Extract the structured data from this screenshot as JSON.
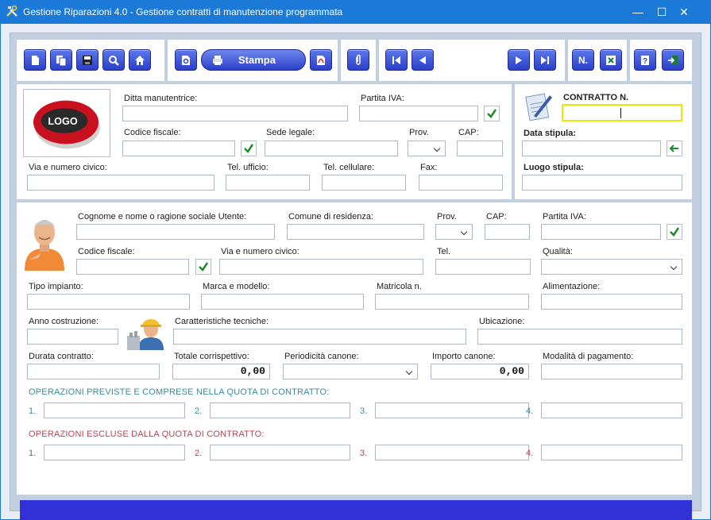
{
  "window": {
    "title": "Gestione Riparazioni 4.0 - Gestione contratti di manutenzione programmata",
    "minimize": "—",
    "maximize": "☐",
    "close": "✕"
  },
  "toolbar": {
    "stampa_label": "Stampa",
    "numero_label": "N.",
    "help_label": "?"
  },
  "maintainer": {
    "logo_text": "LOGO",
    "ditta_label": "Ditta manutentrice:",
    "piva_label": "Partita IVA:",
    "cf_label": "Codice fiscale:",
    "sede_label": "Sede legale:",
    "prov_label": "Prov.",
    "cap_label": "CAP:",
    "via_label": "Via e numero civico:",
    "tel_ufficio_label": "Tel. ufficio:",
    "tel_cell_label": "Tel. cellulare:",
    "fax_label": "Fax:"
  },
  "contract": {
    "numero_label": "CONTRATTO N.",
    "data_label": "Data stipula:",
    "luogo_label": "Luogo stipula:"
  },
  "user": {
    "nome_label": "Cognome e nome o ragione sociale Utente:",
    "comune_label": "Comune di residenza:",
    "prov_label": "Prov.",
    "cap_label": "CAP:",
    "piva_label": "Partita IVA:",
    "cf_label": "Codice fiscale:",
    "via_label": "Via e numero civico:",
    "tel_label": "Tel.",
    "qualita_label": "Qualità:"
  },
  "plant": {
    "tipo_label": "Tipo impianto:",
    "marca_label": "Marca e modello:",
    "matricola_label": "Matricola n.",
    "alimentazione_label": "Alimentazione:",
    "anno_label": "Anno costruzione:",
    "caratteristiche_label": "Caratteristiche tecniche:",
    "ubicazione_label": "Ubicazione:"
  },
  "terms": {
    "durata_label": "Durata contratto:",
    "totale_label": "Totale corrispettivo:",
    "totale_value": "0,00",
    "periodicita_label": "Periodicità canone:",
    "importo_label": "Importo canone:",
    "importo_value": "0,00",
    "modalita_label": "Modalità di pagamento:"
  },
  "operations": {
    "included_title": "OPERAZIONI PREVISTE E COMPRESE NELLA QUOTA DI CONTRATTO:",
    "excluded_title": "OPERAZIONI ESCLUSE DALLA QUOTA DI CONTRATTO:",
    "n1": "1.",
    "n2": "2.",
    "n3": "3.",
    "n4": "4."
  },
  "colors": {
    "titlebar": "#1b79d8",
    "button": "#2c3fc9",
    "included": "#3a8a96",
    "excluded": "#c0404f",
    "highlight": "#e8e800",
    "status": "#3131d8"
  }
}
